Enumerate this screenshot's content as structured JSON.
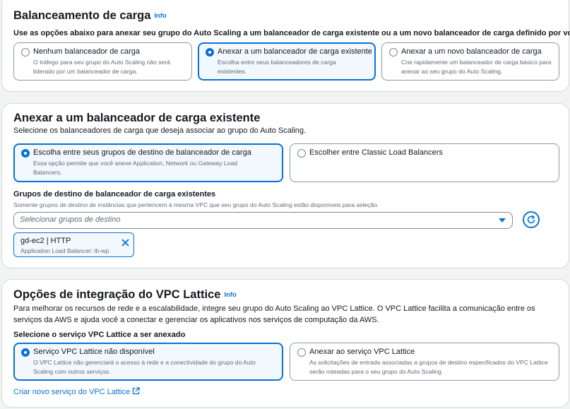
{
  "load_balancing": {
    "title": "Balanceamento de carga",
    "info": "Info",
    "description": "Use as opções abaixo para anexar seu grupo do Auto Scaling a um balanceador de carga existente ou a um novo balanceador de carga definido por você.",
    "options": [
      {
        "title": "Nenhum balanceador de carga",
        "description": "O tráfego para seu grupo do Auto Scaling não será liderado por um balanceador de carga.",
        "selected": false
      },
      {
        "title": "Anexar a um balanceador de carga existente",
        "description": "Escolha entre seus balanceadores de carga existentes.",
        "selected": true
      },
      {
        "title": "Anexar a um novo balanceador de carga",
        "description": "Crie rapidamente um balanceador de carga básico para anexar ao seu grupo do Auto Scaling.",
        "selected": false
      }
    ]
  },
  "attach_existing": {
    "title": "Anexar a um balanceador de carga existente",
    "description": "Selecione os balanceadores de carga que deseja associar ao grupo do Auto Scaling.",
    "options": [
      {
        "title": "Escolha entre seus grupos de destino de balanceador de carga",
        "description": "Essa opção permite que você anexe Application, Network ou Gateway Load Balancers.",
        "selected": true
      },
      {
        "title": "Escolher entre Classic Load Balancers",
        "description": "",
        "selected": false
      }
    ],
    "target_groups_label": "Grupos de destino de balanceador de carga existentes",
    "target_groups_hint": "Somente grupos de destino de instâncias que pertencem à mesma VPC que seu grupo do Auto Scaling estão disponíveis para seleção.",
    "select_placeholder": "Selecionar grupos de destino",
    "token": {
      "name": "gd-ec2 | HTTP",
      "detail": "Application Load Balancer: lb-wp"
    }
  },
  "vpc_lattice": {
    "title": "Opções de integração do VPC Lattice",
    "info": "Info",
    "description": "Para melhorar os recursos de rede e a escalabilidade, integre seu grupo do Auto Scaling ao VPC Lattice. O VPC Lattice facilita a comunicação entre os serviços da AWS e ajuda você a conectar e gerenciar os aplicativos nos serviços de computação da AWS.",
    "select_label": "Selecione o serviço VPC Lattice a ser anexado",
    "options": [
      {
        "title": "Serviço VPC Lattice não disponível",
        "description": "O VPC Lattice não gerenciará o acesso à rede e a conectividade do grupo do Auto Scaling com outros serviços.",
        "selected": true
      },
      {
        "title": "Anexar ao serviço VPC Lattice",
        "description": "As solicitações de entrada associadas a grupos de destino especificados do VPC Lattice serão roteadas para o seu grupo do Auto Scaling.",
        "selected": false
      }
    ],
    "create_link": "Criar novo serviço do VPC Lattice"
  },
  "colors": {
    "accent": "#0972d3",
    "selected_bg": "#f2f8fd",
    "text": "#16191f",
    "muted": "#5f6b7a",
    "border": "#8d99a8"
  },
  "icons": {
    "refresh": "refresh-icon",
    "remove": "close-icon",
    "external": "external-link-icon"
  }
}
